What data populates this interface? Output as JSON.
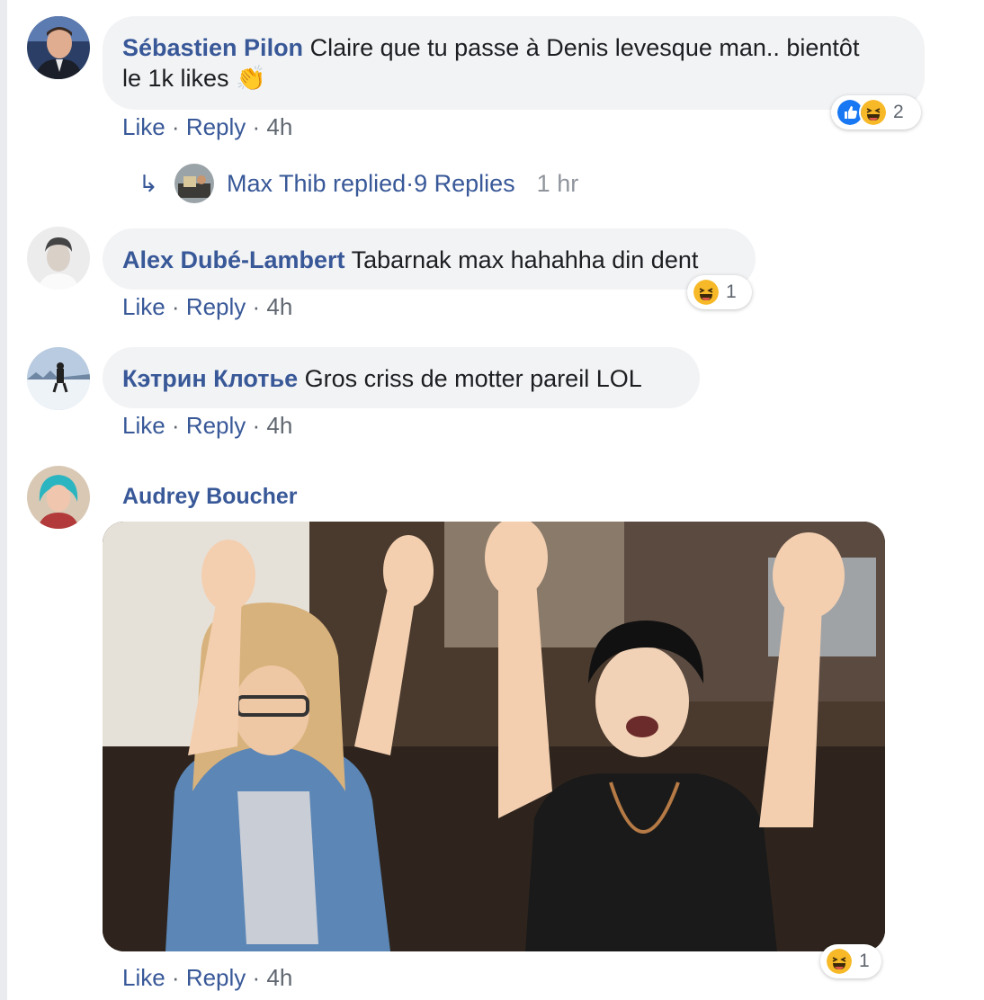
{
  "comments": [
    {
      "author": "Sébastien Pilon",
      "text_line1": "Claire que tu passe à Denis levesque man.. bientôt",
      "text_line2": "le 1k likes",
      "emoji": "👏",
      "reactions": {
        "icons": [
          "like-icon",
          "haha-icon"
        ],
        "count": "2"
      },
      "actions": {
        "like": "Like",
        "reply": "Reply",
        "time": "4h"
      },
      "replies": {
        "arrow": "↳",
        "who": "Max Thib replied",
        "sep": " · ",
        "count": "9 Replies",
        "ago": "1 hr"
      }
    },
    {
      "author": "Alex Dubé-Lambert",
      "text": "Tabarnak max hahahha din dent",
      "reactions": {
        "icons": [
          "haha-icon"
        ],
        "count": "1"
      },
      "actions": {
        "like": "Like",
        "reply": "Reply",
        "time": "4h"
      }
    },
    {
      "author": "Кэтрин Клотье",
      "text": "Gros criss de motter pareil LOL",
      "actions": {
        "like": "Like",
        "reply": "Reply",
        "time": "4h"
      }
    },
    {
      "author": "Audrey Boucher",
      "attachment": "gif",
      "reactions": {
        "icons": [
          "haha-icon"
        ],
        "count": "1"
      },
      "actions": {
        "like": "Like",
        "reply": "Reply",
        "time": "4h"
      }
    }
  ],
  "separator": " · ",
  "colors": {
    "link": "#385898",
    "bubble": "#f2f3f5",
    "meta": "#606770",
    "like_blue": "#1877f2",
    "haha_yellow": "#f7b928"
  }
}
